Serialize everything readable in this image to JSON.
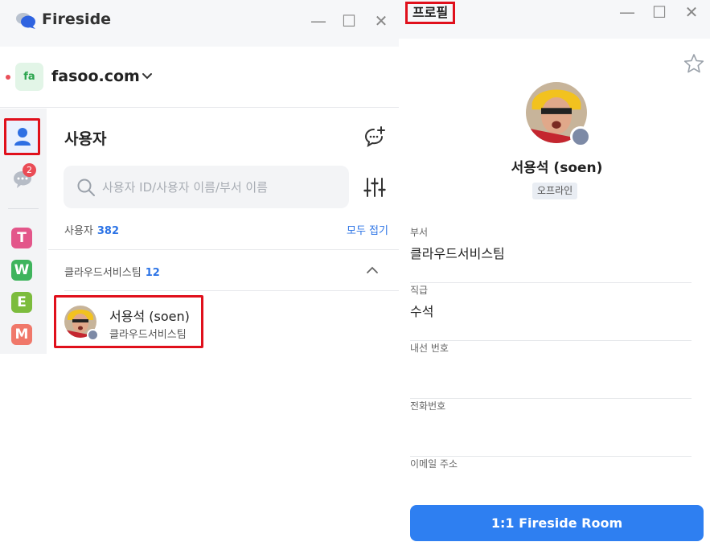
{
  "left_window": {
    "app_name": "Fireside",
    "window_controls": {
      "minimize": "—",
      "maximize": "☐",
      "close": "✕"
    },
    "workspace": {
      "badge": "fa",
      "name": "fasoo.com",
      "icon": "chevron-down-icon"
    },
    "sidebar": {
      "nav": [
        {
          "icon": "user-icon",
          "active": true
        },
        {
          "icon": "chat-bubble-icon",
          "badge": "2"
        }
      ],
      "apps": [
        {
          "letter": "T",
          "color": "#e3568a"
        },
        {
          "letter": "W",
          "color": "#3fb45d"
        },
        {
          "letter": "E",
          "color": "#7cbc3d"
        },
        {
          "letter": "M",
          "color": "#f0786a"
        }
      ]
    },
    "panel": {
      "title": "사용자",
      "new_chat_icon": "chat-add-icon",
      "search_placeholder": "사용자 ID/사용자 이름/부서 이름",
      "filter_icon": "sliders-icon",
      "user_count_label": "사용자",
      "user_count": "382",
      "collapse_all": "모두 접기",
      "group": {
        "name": "클라우드서비스팀",
        "count": "12",
        "icon": "chevron-up-icon"
      },
      "users": [
        {
          "name": "서용석 (soen)",
          "dept": "클라우드서비스팀",
          "status": "offline"
        }
      ]
    }
  },
  "right_window": {
    "title": "프로필",
    "window_controls": {
      "minimize": "—",
      "maximize": "☐",
      "close": "✕"
    },
    "favorite_icon": "star-icon",
    "profile": {
      "name": "서용석 (soen)",
      "status": "오프라인",
      "fields": [
        {
          "label": "부서",
          "value": "클라우드서비스팀"
        },
        {
          "label": "직급",
          "value": "수석"
        },
        {
          "label": "내선 번호",
          "value": ""
        },
        {
          "label": "전화번호",
          "value": ""
        },
        {
          "label": "이메일 주소",
          "value": ""
        }
      ]
    },
    "action_button": "1:1 Fireside Room"
  }
}
